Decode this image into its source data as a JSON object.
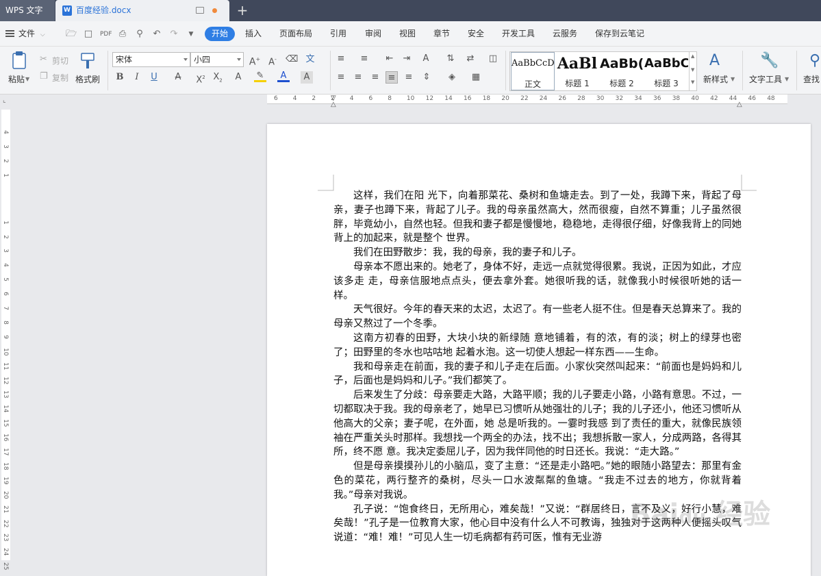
{
  "titlebar": {
    "app_tab": "WPS 文字",
    "doc_tab": "百度经验.docx",
    "doc_icon": "W",
    "new_tab": "+"
  },
  "menubar": {
    "file": "文件",
    "tabs": [
      "开始",
      "插入",
      "页面布局",
      "引用",
      "审阅",
      "视图",
      "章节",
      "安全",
      "开发工具",
      "云服务",
      "保存到云笔记"
    ],
    "active_tab": "开始"
  },
  "ribbon": {
    "paste": "粘贴",
    "cut": "剪切",
    "copy": "复制",
    "format_painter": "格式刷",
    "font_name": "宋体",
    "font_size": "小四",
    "styles": [
      {
        "sample": "AaBbCcD",
        "name": "正文"
      },
      {
        "sample": "AaBl",
        "name": "标题 1"
      },
      {
        "sample": "AaBb(",
        "name": "标题 2"
      },
      {
        "sample": "AaBbC",
        "name": "标题 3"
      }
    ],
    "new_style": "新样式",
    "text_tools": "文字工具",
    "find": "查找"
  },
  "ruler": {
    "h_ticks": [
      "6",
      "4",
      "2",
      "2",
      "4",
      "6",
      "8",
      "10",
      "12",
      "14",
      "16",
      "18",
      "20",
      "22",
      "24",
      "26",
      "28",
      "30",
      "32",
      "34",
      "36",
      "38",
      "40",
      "42",
      "44",
      "46",
      "48"
    ],
    "v_ticks": [
      "4",
      "3",
      "2",
      "1",
      "1",
      "2",
      "3",
      "4",
      "5",
      "6",
      "7",
      "8",
      "9",
      "10",
      "11",
      "12",
      "13",
      "14",
      "15",
      "16",
      "17",
      "18",
      "19",
      "20",
      "21",
      "22",
      "23",
      "24",
      "25"
    ]
  },
  "document": {
    "paragraphs": [
      "这样，我们在阳 光下，向着那菜花、桑树和鱼塘走去。到了一处，我蹲下来，背起了母亲，妻子也蹲下来，背起了儿子。我的母亲虽然高大，然而很瘦，自然不算重；儿子虽然很胖，毕竟幼小，自然也轻。但我和妻子都是慢慢地，稳稳地，走得很仔细，好像我背上的同她背上的加起来，就是整个 世界。",
      "我们在田野散步：我，我的母亲，我的妻子和儿子。",
      "母亲本不愿出来的。她老了，身体不好，走远一点就觉得很累。我说，正因为如此，才应该多走 走，母亲信服地点点头，便去拿外套。她很听我的话，就像我小时候很听她的话一样。",
      "天气很好。今年的春天来的太迟，太迟了。有一些老人挺不住。但是春天总算来了。我的母亲又熬过了一个冬季。",
      "这南方初春的田野，大块小块的新绿随 意地铺着，有的浓，有的淡；树上的绿芽也密了；田野里的冬水也咕咕地 起着水泡。这一切使人想起一样东西——生命。",
      "我和母亲走在前面，我的妻子和儿子走在后面。小家伙突然叫起来：“前面也是妈妈和儿子，后面也是妈妈和儿子。”我们都笑了。",
      "后来发生了分歧：母亲要走大路，大路平顺；我的儿子要走小路，小路有意思。不过，一切都取决于我。我的母亲老了，她早已习惯听从她强壮的儿子；我的儿子还小，他还习惯听从他高大的父亲；妻子呢，在外面，她 总是听我的。一霎时我感 到了责任的重大，就像民族领袖在严重关头时那样。我想找一个两全的办法，找不出；我想拆散一家人，分成两路，各得其所，终不愿 意。我决定委屈儿子，因为我伴同他的时日还长。我说：“走大路。”",
      "但是母亲摸摸孙儿的小脑瓜，变了主意：“还是走小路吧。”她的眼随小路望去：那里有金色的菜花，两行整齐的桑树，尽头一口水波粼粼的鱼塘。“我走不过去的地方，你就背着我。”母亲对我说。",
      "孔子说：“饱食终日，无所用心，难矣哉！”又说：“群居终日，言不及义，好行小慧，难矣哉！”孔子是一位教育大家，他心目中没有什么人不可教诲，独独对于这两种人便摇头叹气说道：“难！难！”可见人生一切毛病都有药可医，惟有无业游"
    ]
  },
  "watermark": "Bai 经验"
}
